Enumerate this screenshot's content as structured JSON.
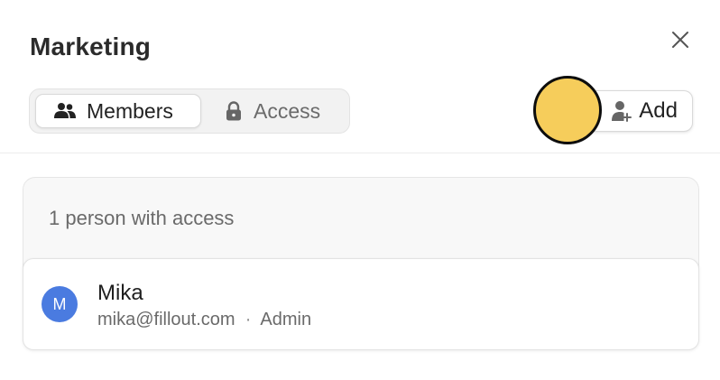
{
  "dialog": {
    "title": "Marketing"
  },
  "tabs": [
    {
      "label": "Members",
      "icon": "people-icon",
      "active": true
    },
    {
      "label": "Access",
      "icon": "lock-icon",
      "active": false
    }
  ],
  "add_button": {
    "label": "Add",
    "icon": "person-add-icon"
  },
  "members_card": {
    "heading": "1 person with access",
    "members": [
      {
        "initial": "M",
        "name": "Mika",
        "email": "mika@fillout.com",
        "separator": "·",
        "role": "Admin"
      }
    ]
  },
  "colors": {
    "avatar": "#4a7be0",
    "cursor_highlight": "#f6cd5b"
  }
}
